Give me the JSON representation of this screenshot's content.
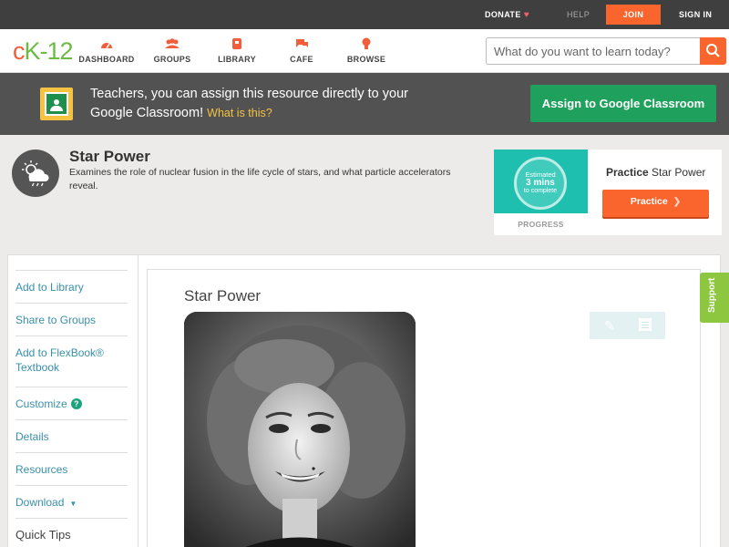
{
  "topbar": {
    "donate": "DONATE",
    "help": "HELP",
    "join": "JOIN",
    "signin": "SIGN IN"
  },
  "nav": {
    "logo": {
      "c": "c",
      "k": "K",
      "dash": "-",
      "num": "12"
    },
    "items": [
      {
        "label": "DASHBOARD",
        "icon": "dashboard-icon"
      },
      {
        "label": "GROUPS",
        "icon": "groups-icon"
      },
      {
        "label": "LIBRARY",
        "icon": "library-icon"
      },
      {
        "label": "CAFE",
        "icon": "cafe-icon"
      },
      {
        "label": "BROWSE",
        "icon": "browse-icon"
      }
    ],
    "search_placeholder": "What do you want to learn today?"
  },
  "banner": {
    "text": "Teachers, you can assign this resource directly to your Google Classroom!",
    "whatis": "What is this?",
    "assign_button": "Assign to Google Classroom"
  },
  "resource": {
    "title": "Star Power",
    "description": "Examines the role of nuclear fusion in the life cycle of stars, and what particle accelerators reveal."
  },
  "practice": {
    "estimated": "Estimated",
    "minutes": "3 mins",
    "to_complete": "to complete",
    "progress_label": "PROGRESS",
    "heading_bold": "Practice",
    "heading_rest": "Star Power",
    "button": "Practice"
  },
  "sidebar": {
    "items": [
      {
        "label": "Add to Library"
      },
      {
        "label": "Share to Groups"
      },
      {
        "label": "Add to FlexBook® Textbook"
      },
      {
        "label": "Customize"
      },
      {
        "label": "Details"
      },
      {
        "label": "Resources"
      },
      {
        "label": "Download"
      }
    ],
    "quick_tips": "Quick Tips"
  },
  "content": {
    "title": "Star Power"
  },
  "support": "Support",
  "colors": {
    "accent_orange": "#f9652c",
    "brand_green": "#6dbb44",
    "link_blue": "#3a8fa9",
    "classroom_green": "#1fa05c"
  }
}
